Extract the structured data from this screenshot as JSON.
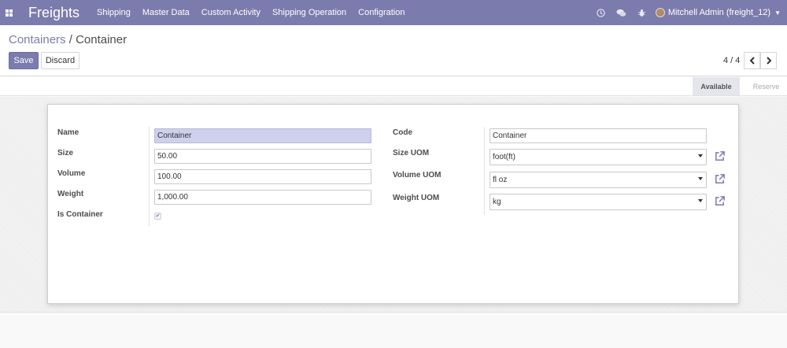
{
  "navbar": {
    "app_name": "Freights",
    "menu": [
      "Shipping",
      "Master Data",
      "Custom Activity",
      "Shipping Operation",
      "Configration"
    ],
    "icons": [
      "clock-icon",
      "chat-icon",
      "bug-icon"
    ],
    "user": "Mitchell Admin (freight_12)"
  },
  "breadcrumb": {
    "parent": "Containers",
    "separator": "/",
    "current": "Container"
  },
  "buttons": {
    "save": "Save",
    "discard": "Discard"
  },
  "pager": {
    "value": "4 / 4",
    "prev": "‹",
    "next": "›"
  },
  "status": {
    "active": "Available",
    "inactive": "Reserve"
  },
  "form": {
    "left": {
      "name_label": "Name",
      "name_value": "Container",
      "size_label": "Size",
      "size_value": "50.00",
      "volume_label": "Volume",
      "volume_value": "100.00",
      "weight_label": "Weight",
      "weight_value": "1,000.00",
      "is_container_label": "Is Container",
      "is_container_checked": true
    },
    "right": {
      "code_label": "Code",
      "code_value": "Container",
      "size_uom_label": "Size UOM",
      "size_uom_value": "foot(ft)",
      "volume_uom_label": "Volume UOM",
      "volume_uom_value": "fl oz",
      "weight_uom_label": "Weight UOM",
      "weight_uom_value": "kg"
    }
  },
  "colors": {
    "brand": "#7c7bad",
    "focused_field": "#cfcfee"
  }
}
